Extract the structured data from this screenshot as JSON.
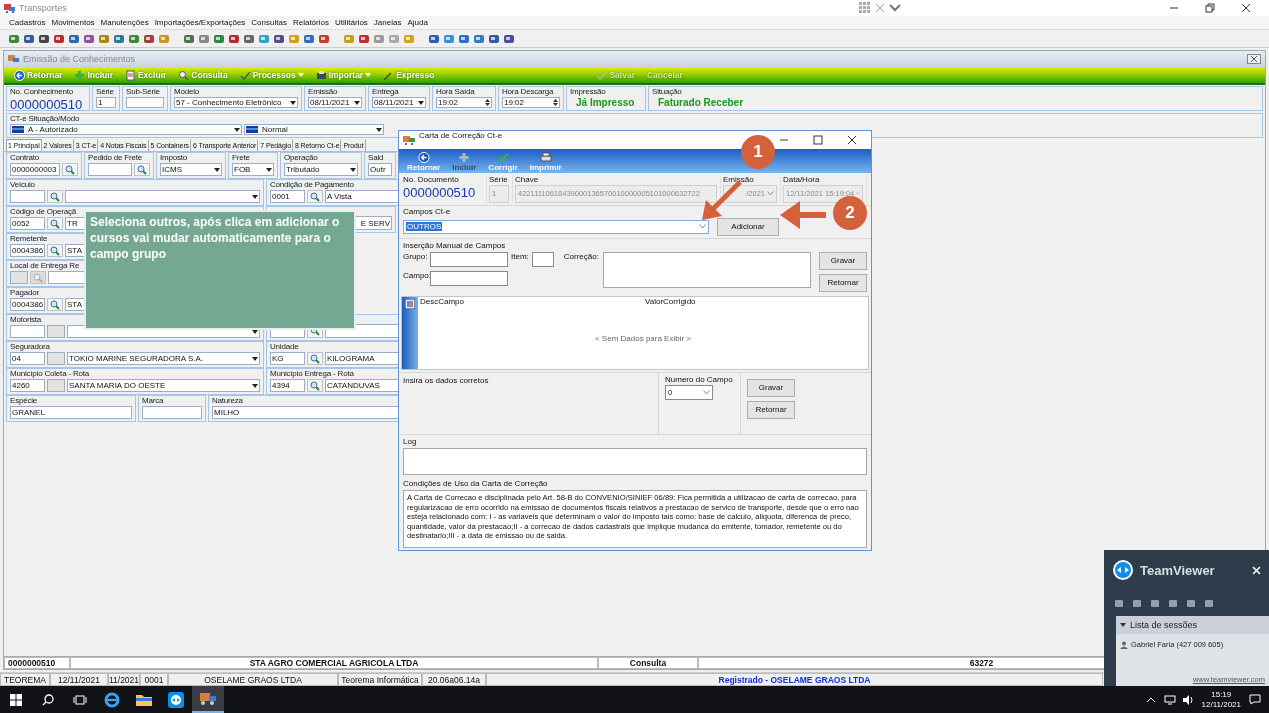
{
  "app": {
    "title": "Transportes",
    "menu": [
      "Cadastros",
      "Movimentos",
      "Manutenções",
      "Importações/Exportações",
      "Consultas",
      "Relatórios",
      "Utilitários",
      "Janelas",
      "Ajuda"
    ]
  },
  "document": {
    "title": "Emissão de Conhecimentos",
    "actions": [
      {
        "label": "Retornar",
        "kind": "back",
        "disabled": false
      },
      {
        "label": "Incluir",
        "kind": "add",
        "disabled": false
      },
      {
        "label": "Excluir",
        "kind": "delete",
        "disabled": false
      },
      {
        "label": "Consulta",
        "kind": "search",
        "disabled": false
      },
      {
        "label": "Processos",
        "kind": "process",
        "disabled": false
      },
      {
        "label": "Importar",
        "kind": "import",
        "disabled": false
      },
      {
        "label": "Expresso",
        "kind": "express",
        "disabled": false
      },
      {
        "label": "Salvar",
        "kind": "save",
        "disabled": true
      },
      {
        "label": "Cancelar",
        "kind": "cancel",
        "disabled": true
      }
    ],
    "header": [
      {
        "label": "No. Conhecimento",
        "fields": [
          {
            "kind": "big",
            "value": "0000000510"
          }
        ]
      },
      {
        "label": "Série",
        "fields": [
          {
            "kind": "text",
            "value": "1"
          }
        ]
      },
      {
        "label": "Sub-Série",
        "fields": [
          {
            "kind": "text"
          }
        ]
      },
      {
        "label": "Modelo",
        "fields": [
          {
            "kind": "select",
            "value": "57 - Conhecimento Eletrônico"
          }
        ]
      },
      {
        "label": "Emissão",
        "fields": [
          {
            "kind": "select",
            "value": "08/11/2021"
          }
        ]
      },
      {
        "label": "Entrega",
        "fields": [
          {
            "kind": "select",
            "value": "08/11/2021"
          }
        ]
      },
      {
        "label": "Hora Saída",
        "fields": [
          {
            "kind": "spin",
            "value": "19:02"
          }
        ]
      },
      {
        "label": "Hora Descarga",
        "fields": [
          {
            "kind": "spin",
            "value": "19:02"
          }
        ]
      },
      {
        "label": "Impressão",
        "fields": [
          {
            "kind": "status",
            "value": "Já Impresso"
          }
        ]
      },
      {
        "label": "Situação",
        "fields": [
          {
            "kind": "status",
            "value": "Faturado Receber"
          }
        ]
      }
    ],
    "situacao": {
      "label": "CT-e Situação/Modo",
      "fields": [
        {
          "kind": "flag",
          "value": "A - Autorizado"
        },
        {
          "kind": "flag",
          "value": "Normal"
        }
      ]
    },
    "tabs": [
      {
        "label": "1 Principal",
        "selected": true
      },
      {
        "label": "2 Valores",
        "selected": false
      },
      {
        "label": "3 CT-e",
        "selected": false
      },
      {
        "label": "4 Notas Fiscais",
        "selected": false
      },
      {
        "label": "5 Containers",
        "selected": false
      },
      {
        "label": "6 Transporte Anterior",
        "selected": false
      },
      {
        "label": "7 Pedágio",
        "selected": false
      },
      {
        "label": "8 Retorno Ct-e",
        "selected": false
      },
      {
        "label": "Produt",
        "selected": false
      }
    ],
    "form_rows": [
      {
        "groups": [
          {
            "label": "Contrato",
            "fields": [
              {
                "kind": "text",
                "value": "0000000003"
              },
              {
                "kind": "lookup"
              }
            ]
          },
          {
            "label": "Pedido de Frete",
            "fields": [
              {
                "kind": "text"
              },
              {
                "kind": "lookup"
              }
            ]
          },
          {
            "label": "Imposto",
            "fields": [
              {
                "kind": "select",
                "value": "ICMS"
              }
            ]
          },
          {
            "label": "Frete",
            "fields": [
              {
                "kind": "select",
                "value": "FOB"
              }
            ]
          },
          {
            "label": "Operação",
            "fields": [
              {
                "kind": "select",
                "value": "Tributado"
              }
            ]
          },
          {
            "label": "Sald",
            "fields": [
              {
                "kind": "text",
                "value": "Outr"
              }
            ]
          }
        ]
      },
      {
        "groups": [
          {
            "label": "Veículo",
            "fields": [
              {
                "kind": "code"
              },
              {
                "kind": "lookup"
              },
              {
                "kind": "select"
              }
            ]
          },
          {
            "label": "Condição de Pagamento",
            "fields": [
              {
                "kind": "code",
                "value": "0001"
              },
              {
                "kind": "lookup"
              },
              {
                "kind": "text",
                "value": "A Vista"
              }
            ]
          }
        ]
      },
      {
        "groups": [
          {
            "label": "Código de Operaçã",
            "fields": [
              {
                "kind": "code",
                "value": "0052"
              },
              {
                "kind": "lookup"
              },
              {
                "kind": "text",
                "value": "TR"
              }
            ]
          },
          {
            "fields": [
              {
                "kind": "tail",
                "value": "E SERV"
              }
            ]
          }
        ]
      },
      {
        "groups": [
          {
            "label": "Remetente",
            "fields": [
              {
                "kind": "code",
                "value": "0004386"
              },
              {
                "kind": "lookup"
              },
              {
                "kind": "text",
                "value": "STA"
              }
            ]
          }
        ]
      },
      {
        "groups": [
          {
            "label": "Local de Entrega Re",
            "fields": [
              {
                "kind": "gray"
              },
              {
                "kind": "lookup_off"
              },
              {
                "kind": "text"
              }
            ]
          }
        ]
      },
      {
        "groups": [
          {
            "label": "Pagador",
            "fields": [
              {
                "kind": "code",
                "value": "0004386"
              },
              {
                "kind": "lookup"
              },
              {
                "kind": "text",
                "value": "STA"
              }
            ]
          }
        ]
      },
      {
        "groups": [
          {
            "label": "Motorista",
            "fields": [
              {
                "kind": "code"
              },
              {
                "kind": "gray"
              },
              {
                "kind": "select"
              }
            ]
          },
          {
            "fields": [
              {
                "kind": "code"
              },
              {
                "kind": "lookup"
              },
              {
                "kind": "text"
              }
            ]
          }
        ]
      },
      {
        "groups": [
          {
            "label": "Seguradora",
            "fields": [
              {
                "kind": "code",
                "value": "04"
              },
              {
                "kind": "gray"
              },
              {
                "kind": "select",
                "value": "TOKIO MARINE SEGURADORA S.A."
              }
            ]
          },
          {
            "label": "Unidade",
            "fields": [
              {
                "kind": "code",
                "value": "KG"
              },
              {
                "kind": "lookup"
              },
              {
                "kind": "text",
                "value": "KILOGRAMA"
              }
            ]
          }
        ]
      },
      {
        "groups": [
          {
            "label": "Município Coleta - Rota",
            "fields": [
              {
                "kind": "code",
                "value": "4260"
              },
              {
                "kind": "gray"
              },
              {
                "kind": "select",
                "value": "SANTA MARIA DO OESTE"
              }
            ]
          },
          {
            "label": "Município Entrega - Rota",
            "fields": [
              {
                "kind": "code",
                "value": "4394"
              },
              {
                "kind": "lookup"
              },
              {
                "kind": "text",
                "value": "CATANDUVAS"
              }
            ]
          }
        ]
      },
      {
        "groups": [
          {
            "label": "Espécie",
            "fields": [
              {
                "kind": "text",
                "value": "GRANEL"
              }
            ]
          },
          {
            "label": "Marca",
            "fields": [
              {
                "kind": "text"
              }
            ]
          },
          {
            "label": "Natureza",
            "fields": [
              {
                "kind": "text",
                "value": "MILHO"
              }
            ]
          }
        ]
      }
    ],
    "status": [
      "0000000510",
      "STA AGRO COMERCIAL AGRICOLA LTDA",
      "Consulta",
      "63272"
    ]
  },
  "app_status": [
    "TEOREMA",
    "12/11/2021",
    "11/2021",
    "0001",
    "OSELAME GRAOS LTDA",
    "Teorema Informática",
    "20.06a06.14a"
  ],
  "registered": "Registrado - OSELAME GRAOS LTDA",
  "tooltip": "Seleciona outros, após clica em adicionar o cursos vai mudar automaticamente para o campo grupo",
  "dialog": {
    "title": "Carta de Correção Ct-e",
    "tools": [
      {
        "label": "Retornar",
        "kind": "back",
        "disabled": false
      },
      {
        "label": "Incluir",
        "kind": "add",
        "disabled": true
      },
      {
        "label": "Corrigir",
        "kind": "check",
        "disabled": false
      },
      {
        "label": "Imprimir",
        "kind": "print",
        "disabled": false
      }
    ],
    "header": [
      {
        "label": "No. Documento",
        "kind": "big",
        "value": "0000000510"
      },
      {
        "label": "Série",
        "kind": "input",
        "value": "1",
        "disabled": true
      },
      {
        "label": "Chave",
        "kind": "input",
        "value": "42211110618439000136570010000005101000632722",
        "disabled": true
      },
      {
        "label": "Emissão",
        "kind": "select",
        "value": "/2021",
        "disabled": true
      },
      {
        "label": "Data/Hora",
        "kind": "select",
        "value": "12/11/2021 15:19:04",
        "disabled": true
      }
    ],
    "campos": {
      "label": "Campos Ct-e",
      "value": "OUTROS",
      "button": "Adicionar"
    },
    "manual": {
      "title": "Inserção Manual de Campos",
      "grupo": "Grupo:",
      "item": "Item:",
      "correcao": "Correção:",
      "campo": "Campo:",
      "buttons": [
        "Gravar",
        "Retornar"
      ]
    },
    "grid": {
      "columns": [
        "DescCampo",
        "ValorCorrigido"
      ],
      "empty": "< Sem Dados para Exibir >"
    },
    "insira": {
      "title": "Insira os dados corretos",
      "numero_label": "Numero do Campo",
      "numero": "0",
      "buttons": [
        "Gravar",
        "Retornar"
      ]
    },
    "log": {
      "title": "Log"
    },
    "conditions": {
      "title": "Condições de Uso da Carta de Correção",
      "text": "A Carta de Correcao e disciplinada pelo Art. 58-B do CONVENIO/SINIEF 06/89: Fica permitida a utilizacao de carta de correcao, para regularizacao de erro ocorrido na emissao de documentos fiscais relativos a prestacao de servico de transporte, desde que o erro nao esteja relacionado com: I - as variaveis que determinam o valor do imposto tais como: base de calculo, aliquota, diferenca de preco, quantidade, valor da prestacao;II - a correcao de dados cadastrais que implique mudanca do emitente, tomador, remetente ou do destinatario;III - a data de emissao ou de saida."
    }
  },
  "callouts": [
    "1",
    "2"
  ],
  "teamviewer": {
    "title": "TeamViewer",
    "sessions_title": "Lista de sessões",
    "session": "Gabriel Faria (427 009 605)",
    "link": "www.teamviewer.com"
  },
  "taskbar": {
    "time": "15:19",
    "date": "12/11/2021"
  }
}
